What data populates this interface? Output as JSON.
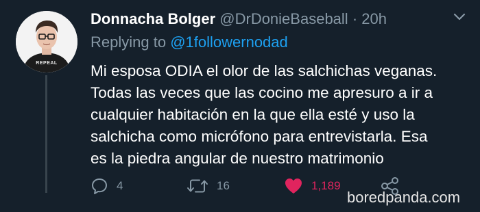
{
  "colors": {
    "background": "#15202b",
    "secondary_text": "#8899a6",
    "link": "#1da1f2",
    "like": "#e0245e",
    "thread_line": "#38444d"
  },
  "tweet": {
    "display_name": "Donnacha Bolger",
    "handle": "@DrDonieBaseball",
    "separator": "·",
    "time": "20h",
    "replying_prefix": "Replying to",
    "replying_to": "@1followernodad",
    "avatar_shirt_text": "REPEAL",
    "text_lines": [
      "Mi esposa ODIA el olor de las salchichas veganas.",
      "Todas las veces que las cocino me apresuro a ir a",
      "cualquier habitación en la que ella esté y uso la",
      "salchicha como micrófono para entrevistarla. Esa",
      "es la piedra angular de nuestro matrimonio"
    ],
    "actions": {
      "reply_count": "4",
      "retweet_count": "16",
      "like_count": "1,189",
      "reply_icon": "reply-icon",
      "retweet_icon": "retweet-icon",
      "like_icon": "heart-icon",
      "share_icon": "share-icon"
    }
  },
  "watermark": "boredpanda.com"
}
